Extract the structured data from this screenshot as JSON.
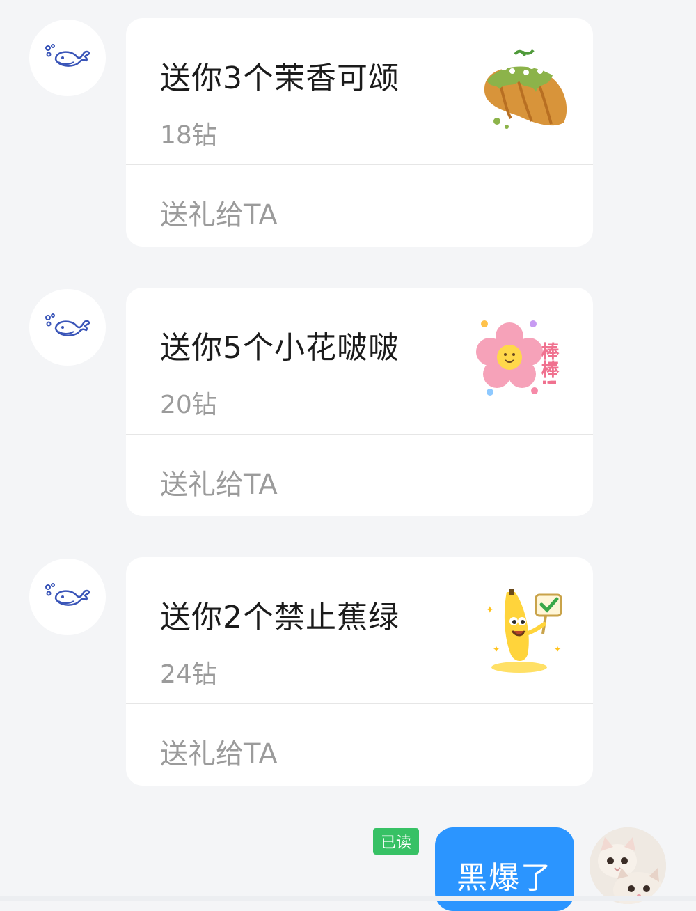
{
  "messages": [
    {
      "avatar_icon": "whale-icon",
      "title": "送你3个茉香可颂",
      "price": "18钻",
      "action_label": "送礼给TA",
      "gift_icon": "croissant-icon"
    },
    {
      "avatar_icon": "whale-icon",
      "title": "送你5个小花啵啵",
      "price": "20钻",
      "action_label": "送礼给TA",
      "gift_icon": "flower-sticker-icon",
      "sticker_text": "棒棒!"
    },
    {
      "avatar_icon": "whale-icon",
      "title": "送你2个禁止蕉绿",
      "price": "24钻",
      "action_label": "送礼给TA",
      "gift_icon": "banana-sticker-icon"
    }
  ],
  "reply": {
    "read_status": "已读",
    "text": "黑爆了",
    "avatar_icon": "cat-avatar-icon"
  },
  "colors": {
    "background": "#f4f5f7",
    "card": "#ffffff",
    "bubble": "#2b95ff",
    "read_badge": "#37c165",
    "whale_stroke": "#3a55b8"
  }
}
